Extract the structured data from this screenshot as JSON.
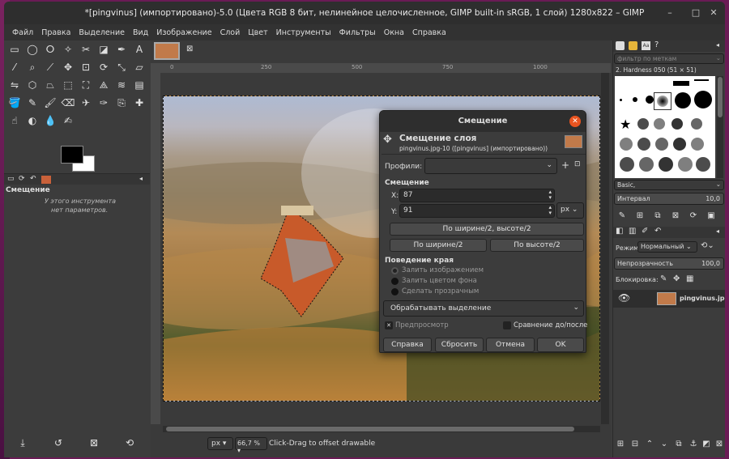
{
  "window": {
    "title": "*[pingvinus] (импортировано)-5.0 (Цвета RGB 8 бит, нелинейное целочисленное, GIMP built-in sRGB, 1 слой) 1280x822 – GIMP",
    "minimize": "–",
    "maximize": "□",
    "close": "✕"
  },
  "menu": [
    "Файл",
    "Правка",
    "Выделение",
    "Вид",
    "Изображение",
    "Слой",
    "Цвет",
    "Инструменты",
    "Фильтры",
    "Окна",
    "Справка"
  ],
  "tool_options": {
    "title": "Смещение",
    "message_line1": "У этого инструмента",
    "message_line2": "нет параметров."
  },
  "ruler": {
    "ticks": [
      "0",
      "250",
      "500",
      "750",
      "1000"
    ]
  },
  "statusbar": {
    "unit": "px",
    "zoom": "66,7 %",
    "hint": "Click-Drag to offset drawable"
  },
  "dialog": {
    "title": "Смещение",
    "heading": "Смещение слоя",
    "subheading": "pingvinus.jpg-10 ([pingvinus] (импортировано))",
    "profiles_label": "Профили:",
    "offset_label": "Смещение",
    "x_label": "X:",
    "x_value": "87",
    "y_label": "Y:",
    "y_value": "91",
    "unit": "px",
    "btn_half_both": "По ширине/2, высоте/2",
    "btn_half_width": "По ширине/2",
    "btn_half_height": "По высоте/2",
    "edge_label": "Поведение края",
    "radio_wrap": "Залить изображением",
    "radio_bg": "Залить цветом фона",
    "radio_transparent": "Сделать прозрачным",
    "process_select": "Обрабатывать выделение",
    "preview_label": "Предпросмотр",
    "compare_label": "Сравнение до/после",
    "btn_help": "Справка",
    "btn_reset": "Сбросить",
    "btn_cancel": "Отмена",
    "btn_ok": "OK"
  },
  "brushes": {
    "filter_placeholder": "фильтр по меткам",
    "current": "2. Hardness 050 (51 × 51)",
    "preset": "Basic,",
    "spacing_label": "Интервал",
    "spacing_value": "10,0"
  },
  "layers": {
    "mode_label": "Режим",
    "mode_value": "Нормальный",
    "opacity_label": "Непрозрачность",
    "opacity_value": "100,0",
    "lock_label": "Блокировка:",
    "layer_name": "pingvinus.jpg"
  },
  "colors": {
    "fg": "#000000",
    "bg": "#ffffff",
    "accent": "#e95420"
  }
}
